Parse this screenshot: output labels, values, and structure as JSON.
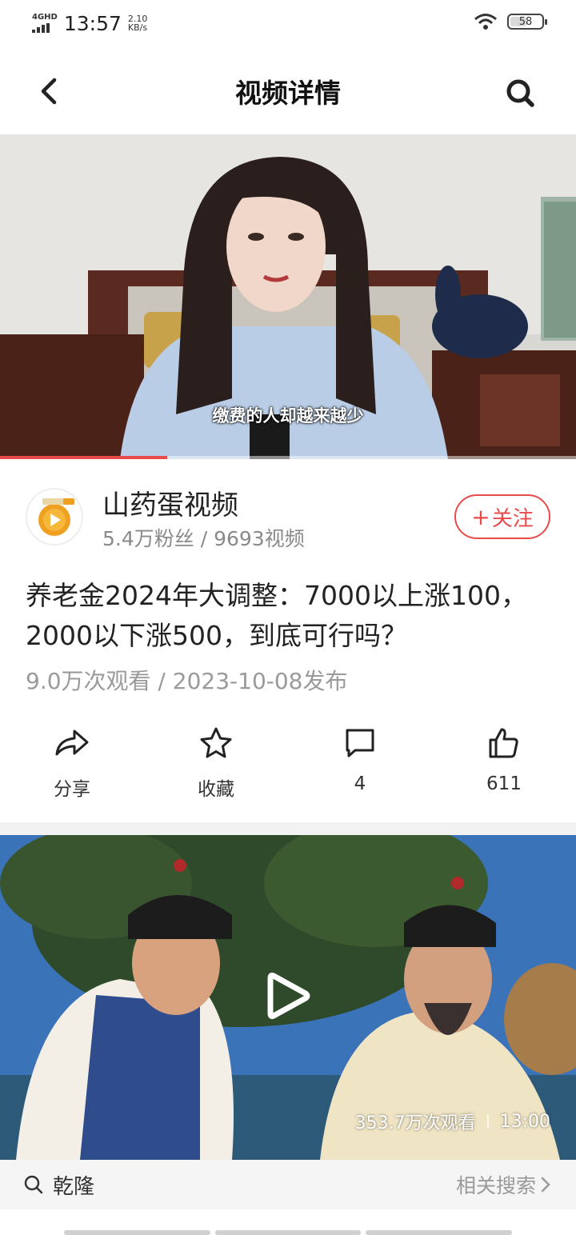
{
  "status_bar": {
    "network": "4GHD",
    "time": "13:57",
    "speed_value": "2.10",
    "speed_unit": "KB/s",
    "battery": "58"
  },
  "header": {
    "title": "视频详情",
    "back_icon": "chevron-left-icon",
    "search_icon": "search-icon"
  },
  "player": {
    "subtitle": "缴费的人却越来越少",
    "progress": 0.29,
    "accent_color": "#e94b4b"
  },
  "author": {
    "name": "山药蛋视频",
    "stats": "5.4万粉丝 / 9693视频",
    "follow_plus": "+",
    "follow_label": "关注"
  },
  "video": {
    "title": "养老金2024年大调整：7000以上涨100，2000以下涨500，到底可行吗？",
    "meta": "9.0万次观看 / 2023-10-08发布"
  },
  "actions": [
    {
      "icon": "share-icon",
      "label": "分享"
    },
    {
      "icon": "star-icon",
      "label": "收藏"
    },
    {
      "icon": "comment-icon",
      "label": "4"
    },
    {
      "icon": "thumbs-up-icon",
      "label": "611"
    }
  ],
  "related_video": {
    "views": "353.7万次观看",
    "duration": "13:00",
    "play_icon": "play-icon"
  },
  "related_search": {
    "query": "乾隆",
    "label": "相关搜索"
  }
}
